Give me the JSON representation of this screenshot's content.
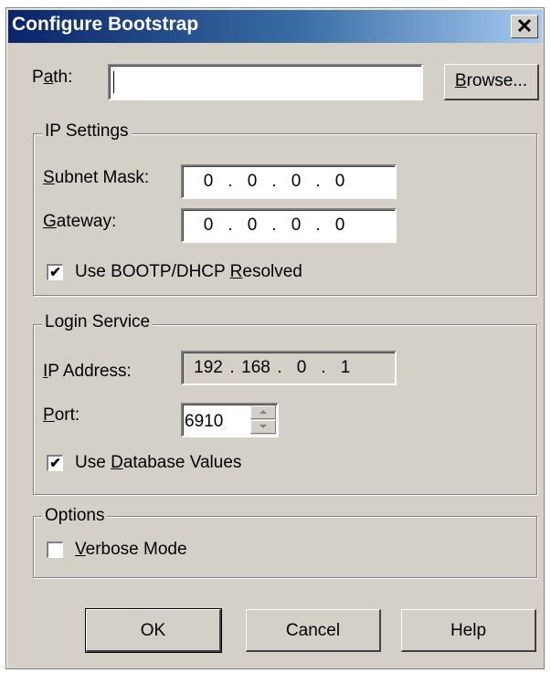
{
  "window": {
    "title": "Configure Bootstrap",
    "close_glyph": "✕"
  },
  "path": {
    "label_pre": "P",
    "label_ul": "a",
    "label_post": "th:",
    "value": "",
    "browse_pre": "",
    "browse_ul": "B",
    "browse_post": "rowse..."
  },
  "ip_settings": {
    "legend": "IP Settings",
    "subnet": {
      "label_ul": "S",
      "label_post": "ubnet Mask:",
      "octets": [
        "0",
        "0",
        "0",
        "0"
      ]
    },
    "gateway": {
      "label_ul": "G",
      "label_post": "ateway:",
      "octets": [
        "0",
        "0",
        "0",
        "0"
      ]
    },
    "bootp": {
      "label_pre": "Use BOOTP/DHCP ",
      "label_ul": "R",
      "label_post": "esolved",
      "checked": true,
      "mark": "✔"
    }
  },
  "login_service": {
    "legend": "Login Service",
    "ip": {
      "label_ul": "I",
      "label_post": "P Address:",
      "octets": [
        "192",
        "168",
        "0",
        "1"
      ]
    },
    "port": {
      "label_ul": "P",
      "label_post": "ort:",
      "value": "6910"
    },
    "dbvalues": {
      "label_pre": "Use ",
      "label_ul": "D",
      "label_post": "atabase Values",
      "checked": true,
      "mark": "✔"
    }
  },
  "options": {
    "legend": "Options",
    "verbose": {
      "label_ul": "V",
      "label_post": "erbose Mode",
      "checked": false
    }
  },
  "buttons": {
    "ok": "OK",
    "cancel": "Cancel",
    "help": "Help"
  }
}
